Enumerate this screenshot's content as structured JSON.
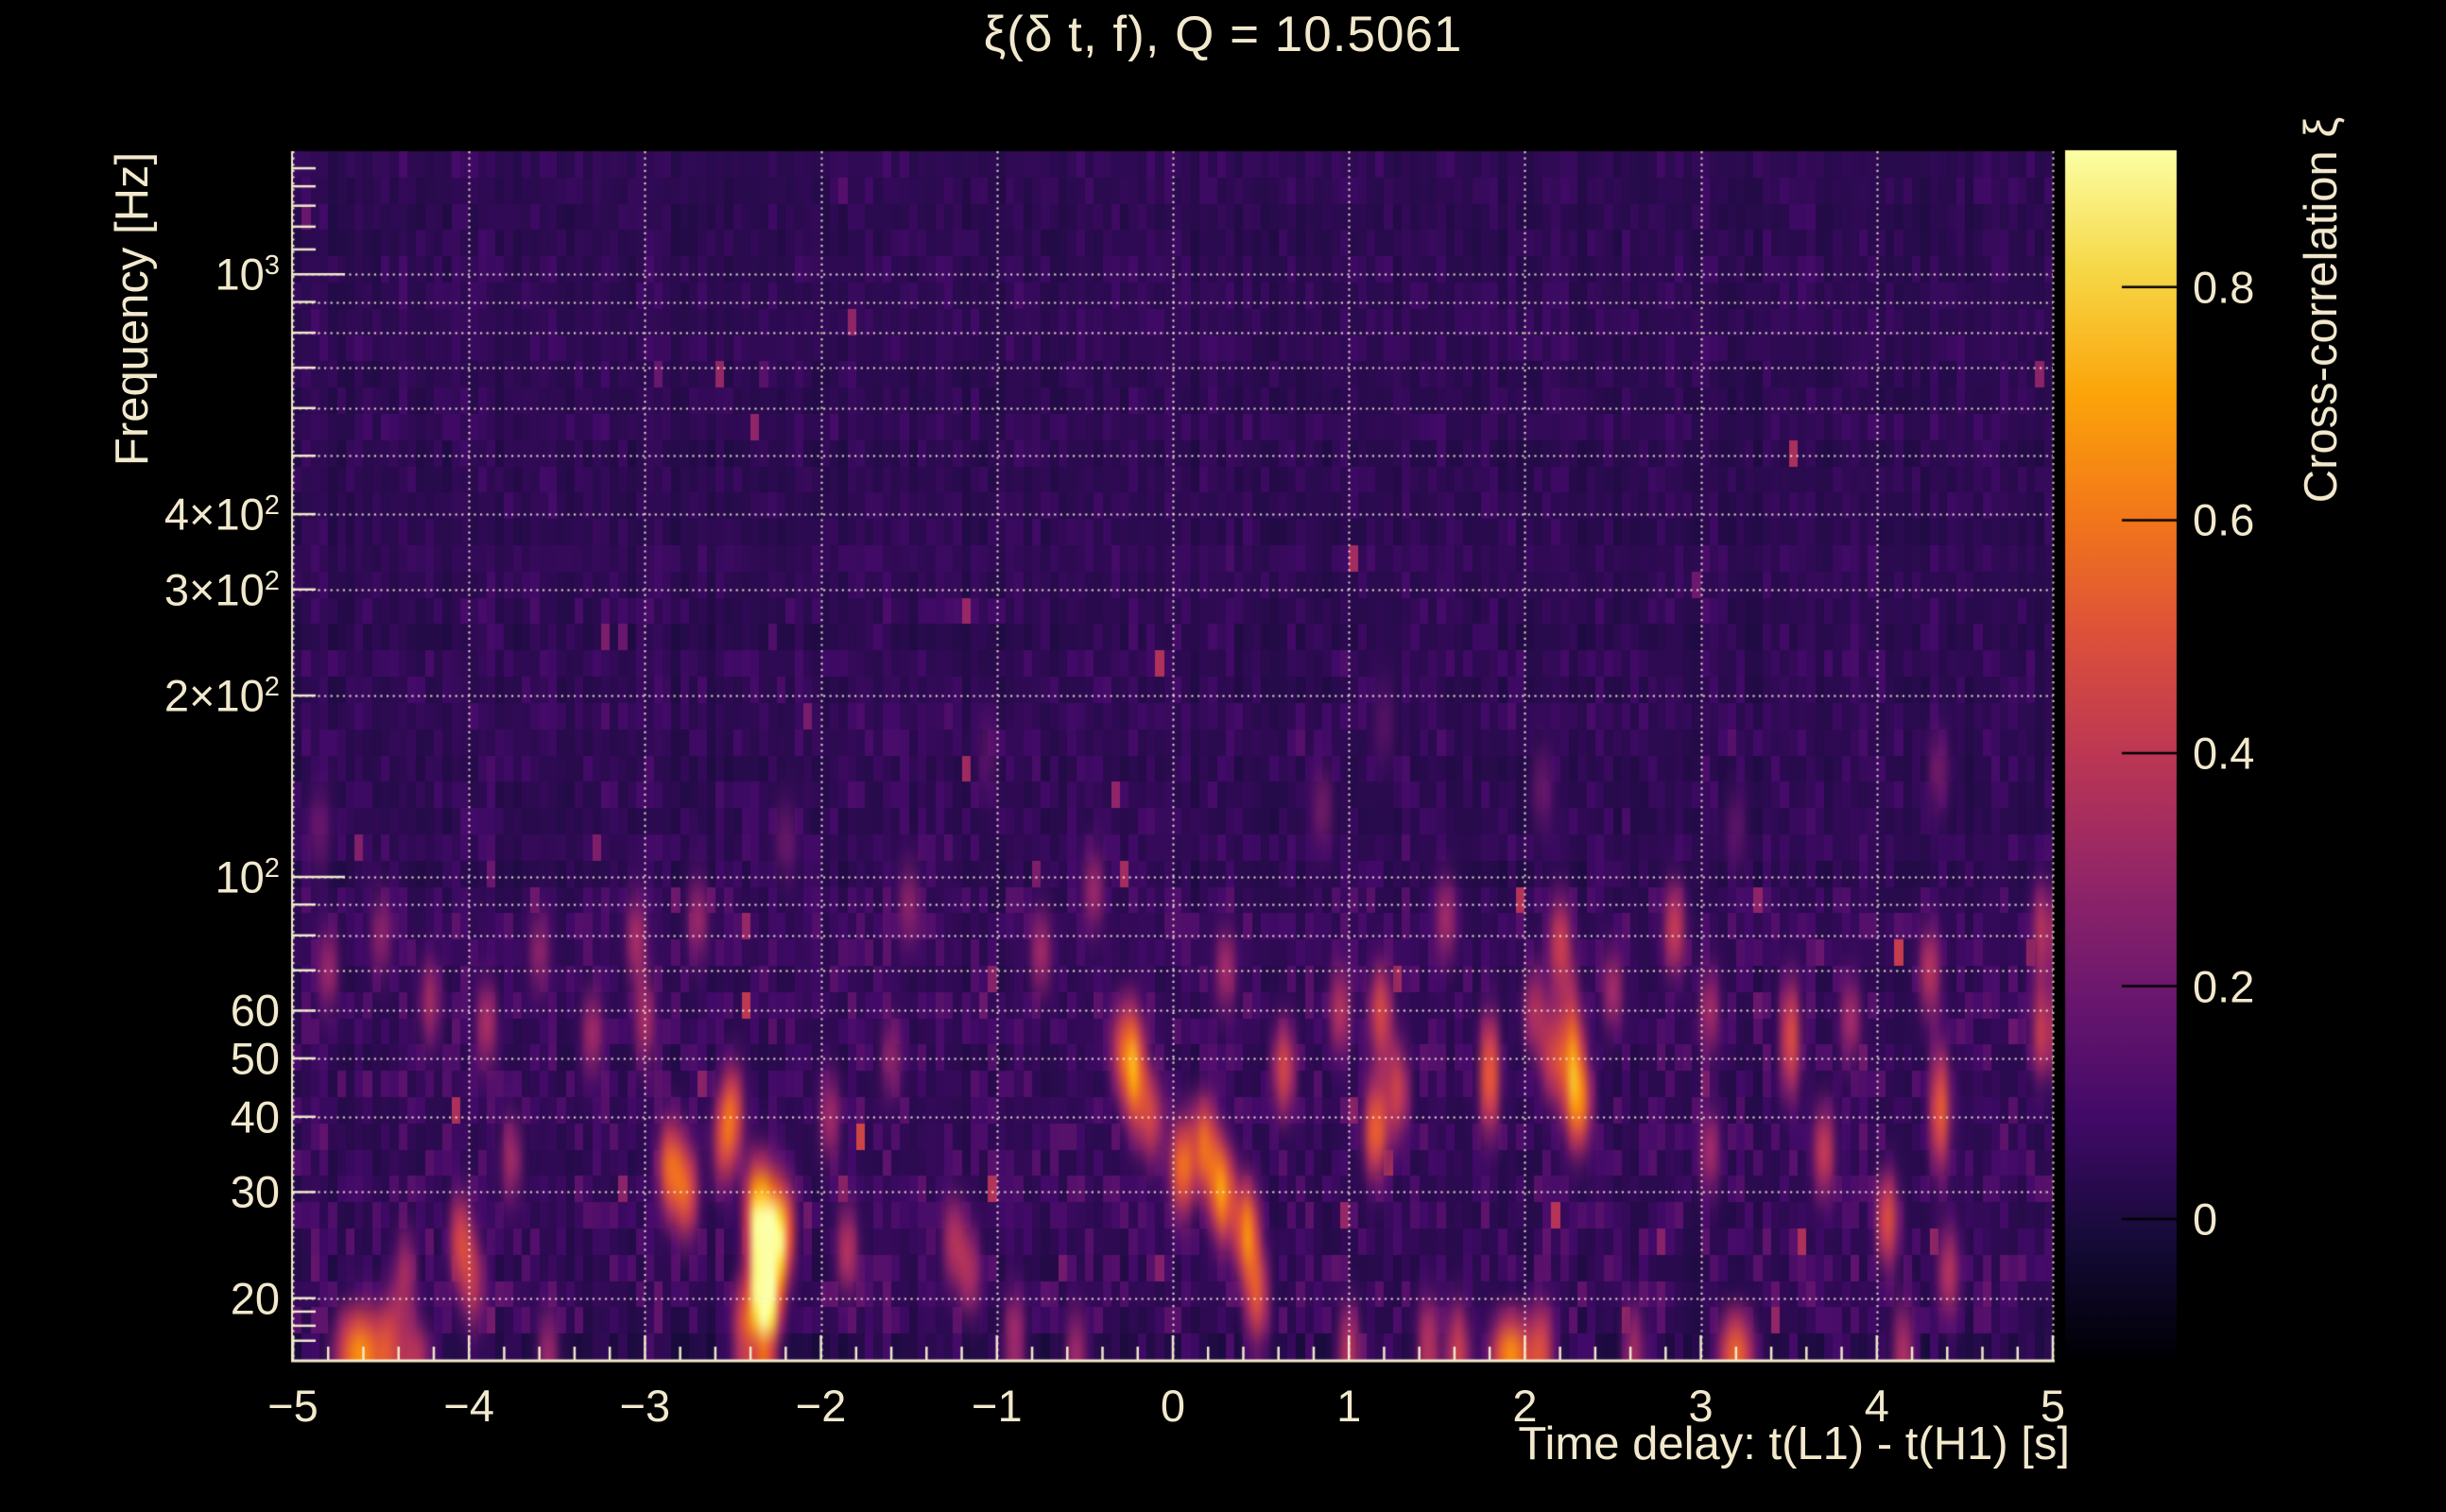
{
  "title": "ξ(δ t, f), Q = 10.5061",
  "colors": {
    "background": "#000000",
    "text": "#f2e9cd",
    "grid": "#f4ecd6",
    "axis": "#f2e9cd",
    "colorbar_tick": "#000000"
  },
  "axes": {
    "x": {
      "title": "Time delay: t(L1) - t(H1) [s]",
      "range": [
        -5,
        5
      ],
      "minor_step": 0.2,
      "ticks": [
        {
          "v": -5,
          "label": "−5"
        },
        {
          "v": -4,
          "label": "−4"
        },
        {
          "v": -3,
          "label": "−3"
        },
        {
          "v": -2,
          "label": "−2"
        },
        {
          "v": -1,
          "label": "−1"
        },
        {
          "v": 0,
          "label": "0"
        },
        {
          "v": 1,
          "label": "1"
        },
        {
          "v": 2,
          "label": "2"
        },
        {
          "v": 3,
          "label": "3"
        },
        {
          "v": 4,
          "label": "4"
        },
        {
          "v": 5,
          "label": "5"
        }
      ]
    },
    "y": {
      "title": "Frequency [Hz]",
      "scale": "log",
      "range_hz": [
        15.8,
        1601
      ],
      "tick_labels": [
        {
          "f": 1000,
          "base": "10",
          "exp": "3"
        },
        {
          "f": 400,
          "base": "4×10",
          "exp": "2"
        },
        {
          "f": 300,
          "base": "3×10",
          "exp": "2"
        },
        {
          "f": 200,
          "base": "2×10",
          "exp": "2"
        },
        {
          "f": 100,
          "base": "10",
          "exp": "2"
        },
        {
          "f": 60,
          "base": "60",
          "exp": ""
        },
        {
          "f": 50,
          "base": "50",
          "exp": ""
        },
        {
          "f": 40,
          "base": "40",
          "exp": ""
        },
        {
          "f": 30,
          "base": "30",
          "exp": ""
        },
        {
          "f": 20,
          "base": "20",
          "exp": ""
        }
      ],
      "grid_freqs": [
        20,
        30,
        40,
        50,
        60,
        70,
        80,
        90,
        100,
        200,
        300,
        400,
        500,
        600,
        700,
        800,
        900,
        1000
      ],
      "minor_tick_freqs": [
        17,
        18,
        19,
        20,
        30,
        40,
        50,
        60,
        70,
        80,
        90,
        200,
        300,
        400,
        500,
        600,
        700,
        800,
        900,
        1100,
        1200,
        1300,
        1400,
        1500
      ],
      "major_tick_freqs": [
        100,
        1000
      ]
    }
  },
  "colorbar": {
    "title": "Cross-correlation ξ",
    "value_range": [
      -0.12,
      0.9175
    ],
    "ticks": [
      {
        "v": 0.8,
        "label": "0.8"
      },
      {
        "v": 0.6,
        "label": "0.6"
      },
      {
        "v": 0.4,
        "label": "0.4"
      },
      {
        "v": 0.2,
        "label": "0.2"
      },
      {
        "v": 0.0,
        "label": "0"
      }
    ]
  },
  "chart_data": {
    "type": "heatmap",
    "title": "ξ(δ t, f), Q = 10.5061",
    "xlabel": "Time delay: t(L1) - t(H1) [s]",
    "ylabel": "Frequency [Hz]",
    "x_range_s": [
      -5,
      5
    ],
    "f_range_hz": [
      15.8,
      1601
    ],
    "value_range": [
      -0.12,
      0.9175
    ],
    "colormap": "inferno",
    "colormap_anchors": [
      "#000004",
      "#160b39",
      "#420a68",
      "#6a176e",
      "#932667",
      "#bc3754",
      "#dd513a",
      "#f37819",
      "#fca50a",
      "#f6d746",
      "#fcffa4"
    ],
    "grid_cols": 200,
    "grid_rows": 46,
    "noise_seed": 1234,
    "noise_bands": [
      {
        "f_min": 300,
        "amp": 0.055,
        "spike_p": 0.005
      },
      {
        "f_min": 100,
        "amp": 0.075,
        "spike_p": 0.006
      },
      {
        "f_min": 60,
        "amp": 0.11,
        "spike_p": 0.018
      },
      {
        "f_min": 25,
        "amp": 0.125,
        "spike_p": 0.016
      },
      {
        "f_min": 18,
        "amp": 0.145,
        "spike_p": 0.012
      },
      {
        "f_min": 0,
        "amp": 0.1,
        "spike_p": 0.01
      }
    ],
    "hotspots": [
      [
        -4.62,
        16.5,
        0.6,
        0.1,
        0.05
      ],
      [
        -4.45,
        17,
        0.28
      ],
      [
        -4.3,
        16.3,
        0.3,
        0.07,
        0.04
      ],
      [
        -4.36,
        22,
        0.28
      ],
      [
        -4.05,
        25,
        0.4
      ],
      [
        -3.97,
        21,
        0.3
      ],
      [
        -3.9,
        57,
        0.3
      ],
      [
        -4.22,
        62,
        0.28
      ],
      [
        -3.76,
        34,
        0.28
      ],
      [
        -3.55,
        16.5,
        0.25
      ],
      [
        -3.3,
        55,
        0.28
      ],
      [
        -3.0,
        57,
        0.28
      ],
      [
        -3.05,
        80,
        0.28
      ],
      [
        -2.86,
        33,
        0.5
      ],
      [
        -2.76,
        30,
        0.45
      ],
      [
        -2.7,
        85,
        0.26
      ],
      [
        -2.5,
        41,
        0.42
      ],
      [
        -2.56,
        36,
        0.33
      ],
      [
        -2.37,
        28,
        0.55
      ],
      [
        -2.3,
        23,
        1.0,
        0.055,
        0.085
      ],
      [
        -2.33,
        19.5,
        0.55
      ],
      [
        -2.44,
        18,
        0.4
      ],
      [
        -2.21,
        26,
        0.5
      ],
      [
        -1.95,
        40,
        0.28
      ],
      [
        -1.85,
        24,
        0.33
      ],
      [
        -1.6,
        50,
        0.24
      ],
      [
        -1.5,
        90,
        0.24
      ],
      [
        -1.25,
        25,
        0.3
      ],
      [
        -1.15,
        22,
        0.28
      ],
      [
        -0.9,
        17.5,
        0.28
      ],
      [
        -0.75,
        75,
        0.28
      ],
      [
        -0.55,
        16.5,
        0.26
      ],
      [
        -0.45,
        95,
        0.26
      ],
      [
        -0.3,
        52,
        0.33
      ],
      [
        -0.22,
        48,
        0.6,
        0.045,
        0.07
      ],
      [
        -0.12,
        40,
        0.38
      ],
      [
        0.05,
        33,
        0.55
      ],
      [
        0.18,
        36,
        0.5
      ],
      [
        0.28,
        30,
        0.62
      ],
      [
        0.3,
        70,
        0.28
      ],
      [
        0.42,
        26,
        0.58
      ],
      [
        0.48,
        20,
        0.42
      ],
      [
        0.63,
        48,
        0.42
      ],
      [
        0.95,
        60,
        0.33
      ],
      [
        1.0,
        16.5,
        0.33
      ],
      [
        1.15,
        38,
        0.52
      ],
      [
        1.28,
        44,
        0.38
      ],
      [
        1.18,
        60,
        0.42
      ],
      [
        1.45,
        17,
        0.33
      ],
      [
        1.62,
        16.5,
        0.38
      ],
      [
        1.8,
        47,
        0.52,
        0.045,
        0.075
      ],
      [
        1.92,
        16.3,
        0.6,
        0.085,
        0.045
      ],
      [
        2.1,
        16.5,
        0.38
      ],
      [
        2.16,
        50,
        0.38
      ],
      [
        2.27,
        50,
        0.52,
        0.045,
        0.085
      ],
      [
        2.32,
        42,
        0.42
      ],
      [
        2.2,
        78,
        0.38
      ],
      [
        2.5,
        65,
        0.28
      ],
      [
        2.62,
        16.5,
        0.28
      ],
      [
        2.85,
        82,
        0.38
      ],
      [
        3.05,
        60,
        0.28
      ],
      [
        3.05,
        35,
        0.28
      ],
      [
        3.2,
        16.5,
        0.5,
        0.075,
        0.045
      ],
      [
        3.51,
        54,
        0.45,
        0.045,
        0.075
      ],
      [
        3.7,
        35,
        0.38
      ],
      [
        3.85,
        58,
        0.28
      ],
      [
        4.06,
        27,
        0.45
      ],
      [
        4.15,
        16.5,
        0.3
      ],
      [
        4.3,
        70,
        0.33
      ],
      [
        4.36,
        41,
        0.5,
        0.045,
        0.075
      ],
      [
        4.41,
        22,
        0.33
      ],
      [
        4.94,
        55,
        0.38
      ],
      [
        4.94,
        82,
        0.33
      ],
      [
        0.85,
        130,
        0.2
      ],
      [
        2.1,
        140,
        0.18
      ],
      [
        -2.2,
        115,
        0.18
      ],
      [
        4.35,
        150,
        0.2
      ],
      [
        -4.85,
        120,
        0.18
      ],
      [
        1.2,
        180,
        0.15
      ],
      [
        -1.05,
        160,
        0.15
      ],
      [
        3.2,
        120,
        0.16
      ],
      [
        1.55,
        85,
        0.28
      ],
      [
        -4.5,
        80,
        0.24
      ],
      [
        -4.8,
        70,
        0.26
      ],
      [
        -3.6,
        75,
        0.24
      ],
      [
        2.05,
        60,
        0.3
      ]
    ]
  }
}
